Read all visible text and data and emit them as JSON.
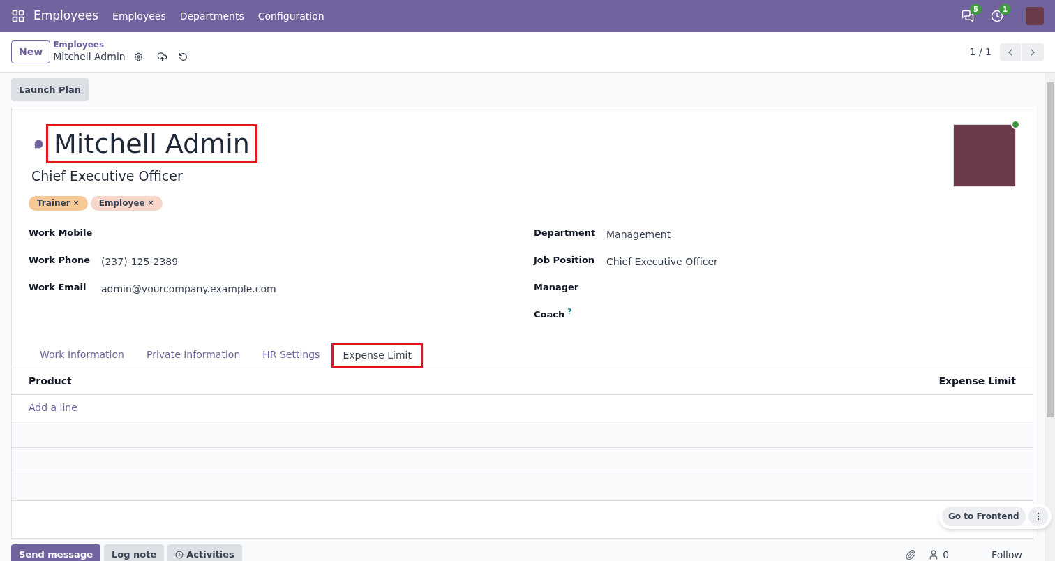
{
  "navbar": {
    "app_name": "Employees",
    "menu": [
      "Employees",
      "Departments",
      "Configuration"
    ],
    "messages_count": "5",
    "activities_count": "1"
  },
  "control_panel": {
    "new_button": "New",
    "breadcrumb": "Employees",
    "record_name": "Mitchell Admin",
    "pager": "1 / 1"
  },
  "action_buttons": [
    "Launch Plan"
  ],
  "employee": {
    "name": "Mitchell Admin",
    "name_highlighted": true,
    "job_title": "Chief Executive Officer",
    "online": true,
    "tags": [
      {
        "label": "Trainer",
        "remove": "×",
        "color": "#f5c896"
      },
      {
        "label": "Employee",
        "remove": "×",
        "color": "#f7d5c9"
      }
    ]
  },
  "fields_left": [
    {
      "label": "Work Mobile"
    },
    {
      "label": "Work Phone",
      "value": "(237)-125-2389"
    },
    {
      "label": "Work Email",
      "value": "admin@yourcompany.example.com"
    }
  ],
  "fields_right": [
    {
      "label": "Department",
      "value": "Management"
    },
    {
      "label": "Job Position",
      "value": "Chief Executive Officer"
    },
    {
      "label": "Manager"
    },
    {
      "label": "Coach",
      "help": "?"
    }
  ],
  "tabs": [
    {
      "label": "Work Information",
      "selected": false,
      "highlighted": false
    },
    {
      "label": "Private Information",
      "selected": false,
      "highlighted": false
    },
    {
      "label": "HR Settings",
      "selected": false,
      "highlighted": false
    },
    {
      "label": "Expense Limit",
      "selected": true,
      "highlighted": true
    }
  ],
  "table": {
    "columns": [
      "Product",
      "Expense Limit"
    ],
    "add_line": "Add a line"
  },
  "floating": {
    "button": "Go to Frontend"
  },
  "chatter": {
    "buttons": [
      {
        "label": "Send message",
        "selected": true
      },
      {
        "label": "Log note",
        "selected": false
      },
      {
        "label": "Activities",
        "selected": false
      }
    ],
    "followers": "0",
    "follow": "Follow"
  }
}
